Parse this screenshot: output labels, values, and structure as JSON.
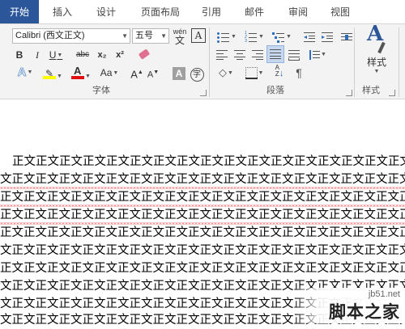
{
  "tabs": [
    "开始",
    "插入",
    "设计",
    "页面布局",
    "引用",
    "邮件",
    "审阅",
    "视图"
  ],
  "font_group": {
    "font_name": "Calibri (西文正文)",
    "font_size": "五号",
    "phonetic_label": "wén",
    "bold": "B",
    "italic": "I",
    "underline": "U",
    "strike": "abc",
    "subscript": "x₂",
    "superscript": "x²",
    "case_label": "Aa",
    "grow": "A",
    "shrink": "A",
    "enclosed_char": "字",
    "label": "字体"
  },
  "paragraph_group": {
    "label": "段落"
  },
  "styles_group": {
    "button_label": "样式",
    "label": "样式"
  },
  "colors": {
    "accent": "#2b579a",
    "highlight": "#ffff00",
    "font_color": "#e01010"
  },
  "document": {
    "lines": [
      "正文正文正文正文正文正文正文正文正文正文正文正文正文正文正文正文正文正文正文正文正文正文正文正文",
      "文正文正文正文正文正文正文正文正文正文正文正文正文正文正文正文正文正文正文正文正文正文正文正文正文正",
      "正文正文正文正文正文正文正文正文正文正文正文正文正文正文正文正文正文正文正文正文正文正文正文正文正文正文",
      "正文正文正文正文正文正文正文正文正文正文正文正文正文正文正文正文正文正文正文正文正文正文正文正文正文正文",
      "正文正文正文正文正文正文正文正文正文正文正文正文正文正文正文正文正文正文正文正文正文正文正文正文正文正文",
      "文正文正文正文正文正文正文正文正文正文正文正文正文正文正文正文正文正文正文正文正文正文正文正文正文正",
      "正文正文正文正文正文正文正文正文正文正文正文正文正文正文正文正文正文正文正文正文正文正文正文正文正文正文",
      "文正文正文正文正文正文正文正文正文正文正文正文正文正文正文正文正文正文正文正文正文正文正文正文正文正",
      "文正文正文正文正文正文正文正文正文正文正文正文正文正文正文正文正文正文正文正文正文正文正文正文正文正",
      "文正文正文正文正文正文正文正文正文正文正文正文正文正文正文正文正文正文正文正文正文正文正文正文正文正"
    ]
  },
  "watermark": {
    "site": "jb51.net",
    "name": "脚本之家"
  }
}
